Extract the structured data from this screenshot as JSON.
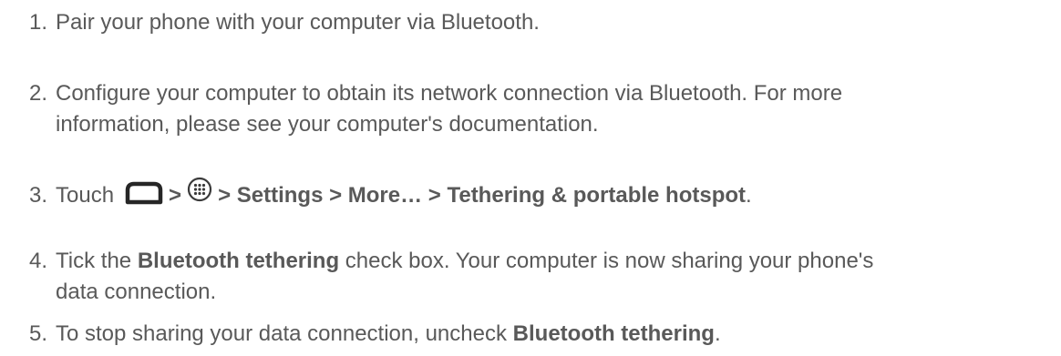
{
  "steps": [
    {
      "number": "1.",
      "text": "Pair your phone with your computer via Bluetooth."
    },
    {
      "number": "2.",
      "line1": "Configure your computer to obtain its network connection via Bluetooth. For more",
      "line2": "information, please see your computer's documentation."
    },
    {
      "number": "3.",
      "touch": "Touch",
      "home_icon": "home-icon",
      "sep1": ">",
      "apps_icon": "apps-icon",
      "path": "> Settings > More… > Tethering & portable hotspot",
      "end": "."
    },
    {
      "number": "4.",
      "pre": "Tick the ",
      "bold": "Bluetooth tethering",
      "post": " check box. Your computer is now sharing your phone's",
      "line2": "data connection."
    },
    {
      "number": "5.",
      "pre": "To stop sharing your data connection, uncheck ",
      "bold": "Bluetooth tethering",
      "end": "."
    }
  ]
}
